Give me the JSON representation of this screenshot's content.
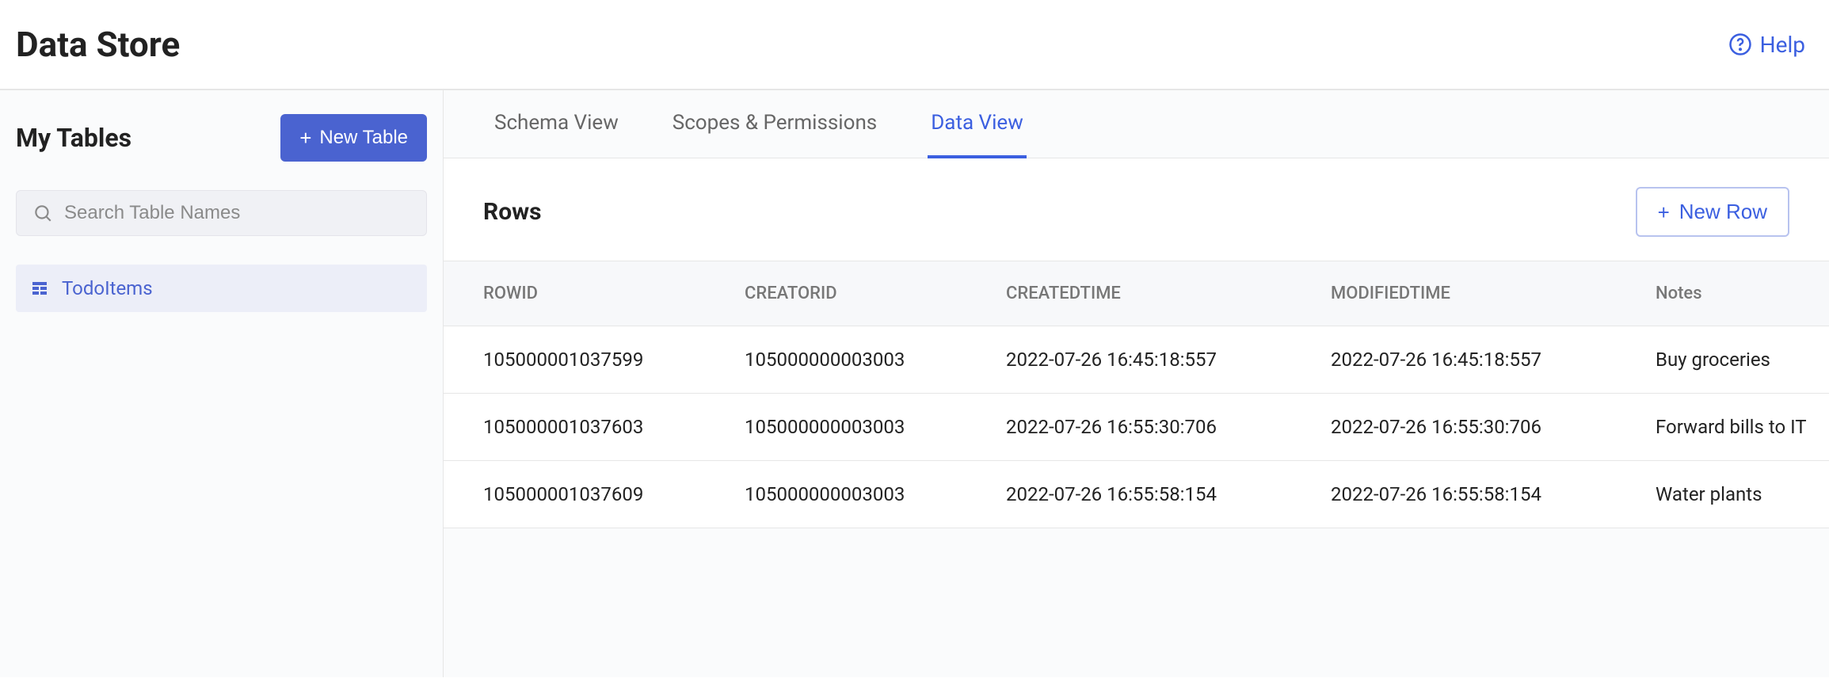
{
  "header": {
    "title": "Data Store",
    "help_label": "Help"
  },
  "sidebar": {
    "title": "My Tables",
    "new_table_label": "New Table",
    "search_placeholder": "Search Table Names",
    "items": [
      {
        "label": "TodoItems"
      }
    ]
  },
  "tabs": [
    {
      "label": "Schema View",
      "active": false
    },
    {
      "label": "Scopes & Permissions",
      "active": false
    },
    {
      "label": "Data View",
      "active": true
    }
  ],
  "rows_section": {
    "title": "Rows",
    "new_row_label": "New Row"
  },
  "table": {
    "columns": [
      "ROWID",
      "CREATORID",
      "CREATEDTIME",
      "MODIFIEDTIME",
      "Notes"
    ],
    "rows": [
      {
        "rowid": "105000001037599",
        "creatorid": "105000000003003",
        "createdtime": "2022-07-26 16:45:18:557",
        "modifiedtime": "2022-07-26 16:45:18:557",
        "notes": "Buy groceries"
      },
      {
        "rowid": "105000001037603",
        "creatorid": "105000000003003",
        "createdtime": "2022-07-26 16:55:30:706",
        "modifiedtime": "2022-07-26 16:55:30:706",
        "notes": "Forward bills to IT"
      },
      {
        "rowid": "105000001037609",
        "creatorid": "105000000003003",
        "createdtime": "2022-07-26 16:55:58:154",
        "modifiedtime": "2022-07-26 16:55:58:154",
        "notes": "Water plants"
      }
    ]
  }
}
